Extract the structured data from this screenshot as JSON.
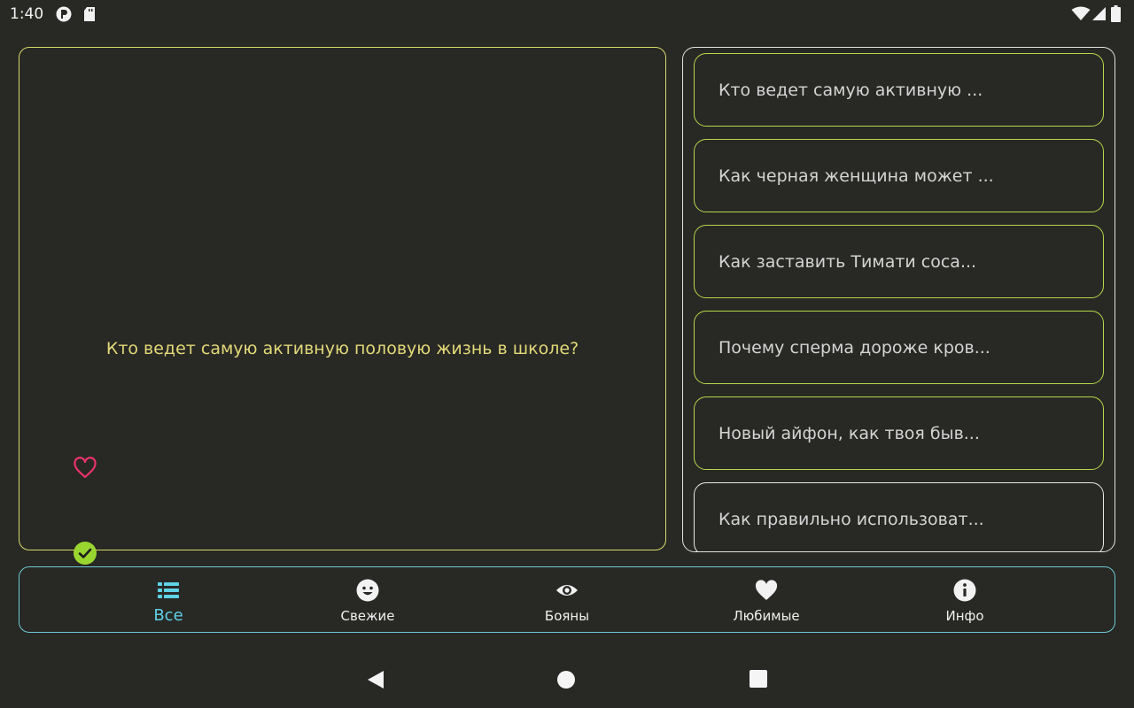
{
  "status_bar": {
    "time": "1:40",
    "left_icons": [
      "app-icon",
      "sd-card-icon"
    ],
    "right_icons": [
      "wifi-icon",
      "signal-icon",
      "battery-icon"
    ]
  },
  "question_card": {
    "text": "Кто ведет самую активную половую жизнь в школе?",
    "favorite_icon": "heart-outline-icon",
    "done_icon": "check-circle-icon",
    "colors": {
      "border": "#d8d86a",
      "text": "#e2d978",
      "heart": "#e8336b",
      "check": "#9ad630"
    }
  },
  "question_list": {
    "items": [
      {
        "label": "Кто ведет самую активную ..."
      },
      {
        "label": "Как черная женщина может ..."
      },
      {
        "label": "Как заставить Тимати соса..."
      },
      {
        "label": "Почему сперма дороже кров..."
      },
      {
        "label": "Новый айфон, как твоя быв..."
      },
      {
        "label": "Как правильно использоват..."
      }
    ]
  },
  "bottom_nav": {
    "items": [
      {
        "label": "Все",
        "icon": "list-icon",
        "active": true
      },
      {
        "label": "Свежие",
        "icon": "smiley-icon",
        "active": false
      },
      {
        "label": "Бояны",
        "icon": "eye-icon",
        "active": false
      },
      {
        "label": "Любимые",
        "icon": "heart-icon",
        "active": false
      },
      {
        "label": "Инфо",
        "icon": "info-icon",
        "active": false
      }
    ],
    "colors": {
      "border": "#6fc9d6",
      "active": "#5fd2e6"
    }
  },
  "system_nav": {
    "buttons": [
      "back-icon",
      "home-icon",
      "recents-icon"
    ]
  }
}
